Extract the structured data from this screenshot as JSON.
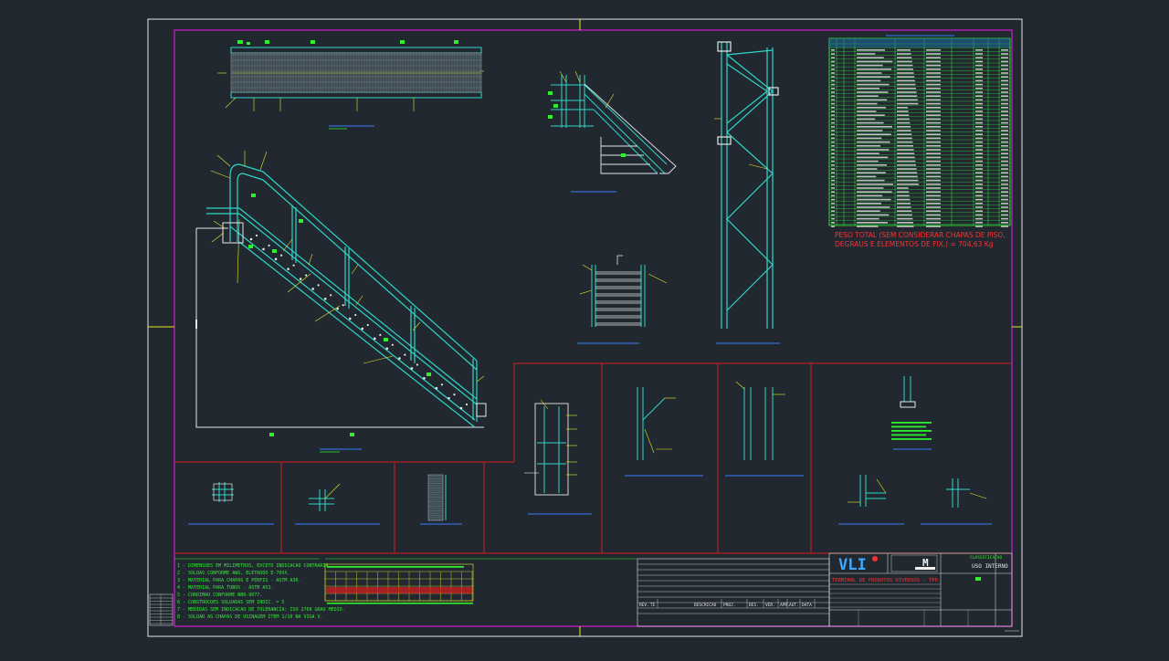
{
  "colors": {
    "background": "#212830",
    "sheet_border": "#e6e6e6",
    "drawing_frame": "#d21fd2",
    "section_lines": "#d21f1f",
    "structure": "#2fd6c8",
    "green": "#2ef02e",
    "yellow": "#e8e82a",
    "blue_labels": "#3a7bff",
    "red_text": "#ff3030",
    "white": "#f0f0f0"
  },
  "weight_note": {
    "line1": "PESO TOTAL (SEM CONSIDERAR CHAPAS DE PISO,",
    "line2": "DEGRAUS E ELEMENTOS DE FIX.) = 704,63 Kg"
  },
  "general_notes": [
    "1 - DIMENSOES EM MILIMETROS, EXCETO INDICACAO CONTRARIA.",
    "2 - SOLDAS CONFORME AWS, ELETRODO E-70XX.",
    "3 - MATERIAL PARA CHAPAS E PERFIS - ASTM A36.",
    "4 - MATERIAL PARA TUBOS - ASTM A53.",
    "5 - CORRIMAO CONFORME NBR-9077.",
    "6 - CONSTRUCOES SOLDADAS SEM INDIC. = 5",
    "7 - MEDIDAS SEM INDICACAO DE TOLERANCIA: ISO 2768 GRAU MEDIO.",
    "8 - SOLDAR AS CHAPAS DE USINAGEM ITEM 1/10 NA VIGA V."
  ],
  "title_block": {
    "client_logo": "VLI",
    "company_logo": "M",
    "classification_label": "CLASSIFICACAO",
    "classification_value": "USO INTERNO",
    "drawing_title": "TERMINAL DE PRODUTOS DIVERSOS - TPD",
    "revision_headers": [
      "REV.",
      "TE",
      "DESCRICAO",
      "PROJ.",
      "DES.",
      "VER.",
      "APR.",
      "AUT.",
      "DATA"
    ]
  }
}
